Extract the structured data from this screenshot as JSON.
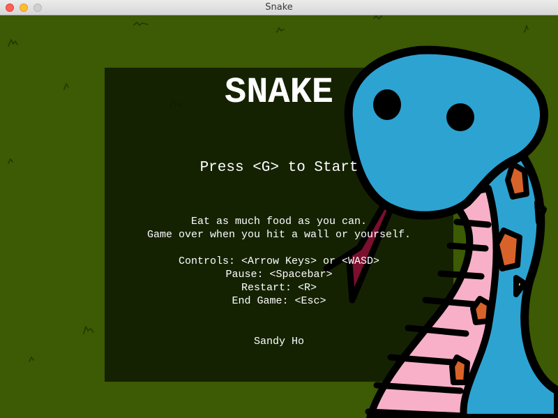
{
  "window": {
    "title": "Snake"
  },
  "game": {
    "title": "SNAKE",
    "start_prompt": "Press <G> to Start",
    "instructions": [
      "Eat as much food as you can.",
      "Game over when you hit a wall or yourself."
    ],
    "controls": [
      "Controls: <Arrow Keys> or <WASD>",
      "Pause: <Spacebar>",
      "Restart: <R>",
      "End Game: <Esc>"
    ],
    "author": "Sandy Ho"
  },
  "colors": {
    "grass": "#3d5a04",
    "panel": "#0c1602",
    "snake_body": "#2da3d2",
    "snake_belly": "#f7b0c8",
    "tongue": "#7a0f2e",
    "scale_orange": "#d8632a",
    "scale_yellow": "#f2e600",
    "text": "#ffffff"
  }
}
